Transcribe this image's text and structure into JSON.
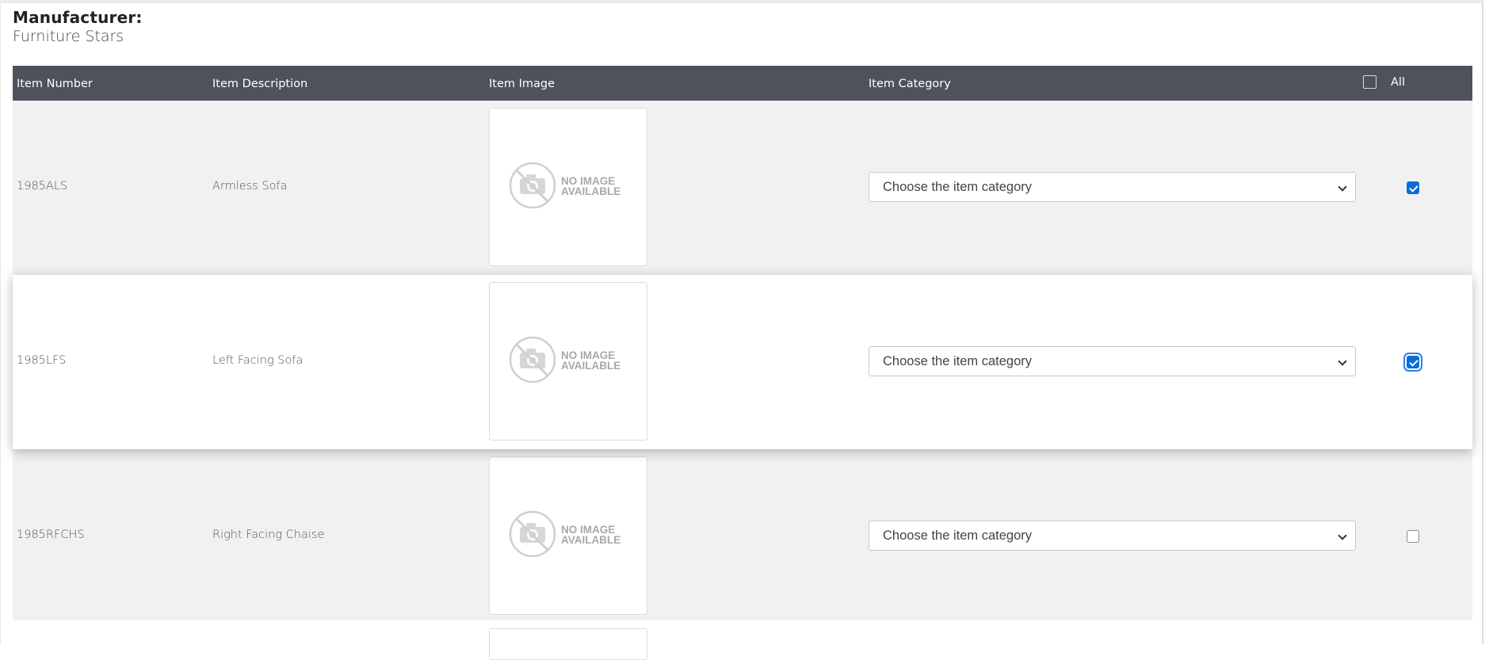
{
  "manufacturer": {
    "label": "Manufacturer:",
    "name": "Furniture Stars"
  },
  "table": {
    "headers": {
      "item_number": "Item Number",
      "item_description": "Item Description",
      "item_image": "Item Image",
      "item_category": "Item Category",
      "all": "All"
    },
    "select_all_checked": false,
    "rows": [
      {
        "item_number": "1985ALS",
        "item_description": "Armless Sofa",
        "image_text_line1": "NO IMAGE",
        "image_text_line2": "AVAILABLE",
        "category_placeholder": "Choose the item category",
        "checked": true
      },
      {
        "item_number": "1985LFS",
        "item_description": "Left Facing Sofa",
        "image_text_line1": "NO IMAGE",
        "image_text_line2": "AVAILABLE",
        "category_placeholder": "Choose the item category",
        "checked": true
      },
      {
        "item_number": "1985RFCHS",
        "item_description": "Right Facing Chaise",
        "image_text_line1": "NO IMAGE",
        "image_text_line2": "AVAILABLE",
        "category_placeholder": "Choose the item category",
        "checked": false
      }
    ]
  },
  "colors": {
    "header_bg": "#4d525c",
    "row_alt_bg": "#f1f1f1",
    "checkbox_checked": "#0b6bd8"
  },
  "icons": {
    "no_image": "camera-slash-icon",
    "dropdown": "chevron-down-icon",
    "checkbox": "checkbox-icon"
  }
}
